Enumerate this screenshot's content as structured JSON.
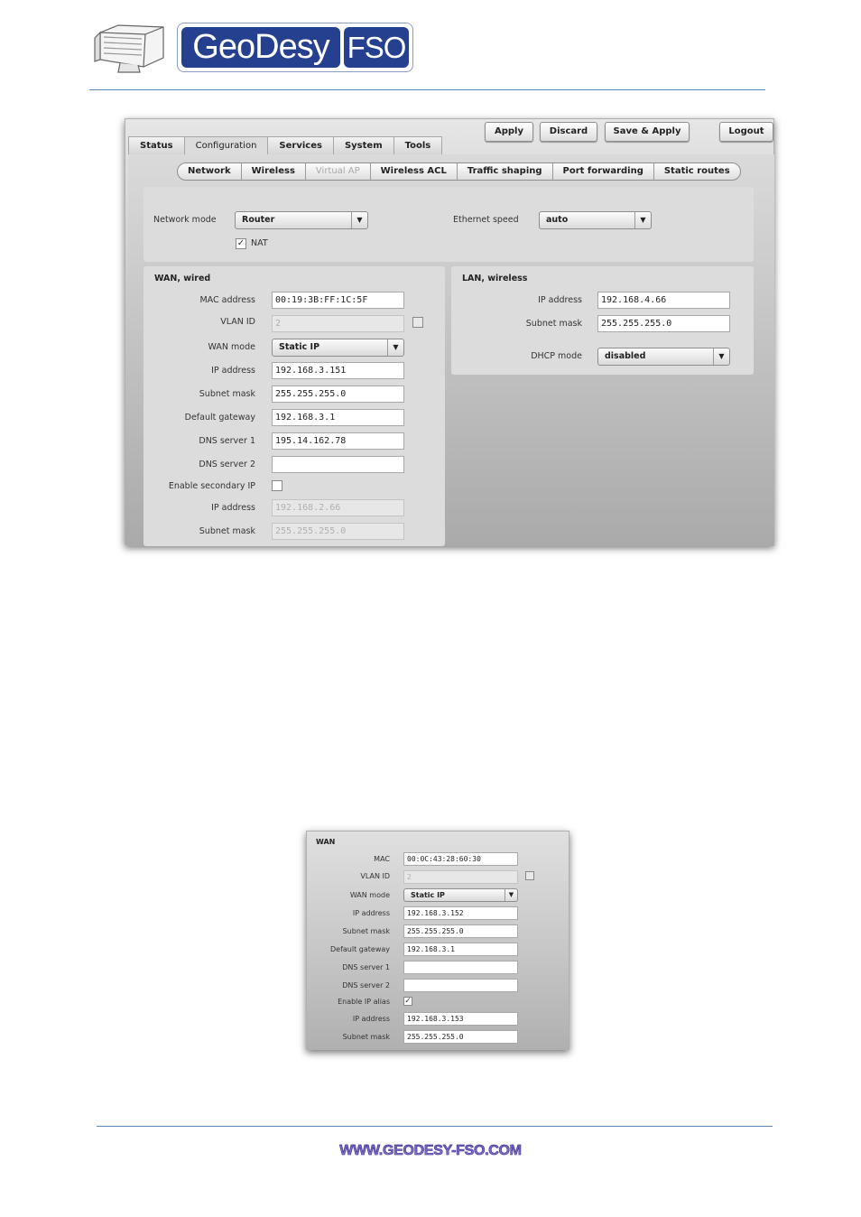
{
  "header": {
    "logo_geo": "GeoDesy",
    "logo_fso": "FSO"
  },
  "shot1": {
    "tabs": [
      {
        "label": "Status",
        "active": false
      },
      {
        "label": "Configuration",
        "active": true
      },
      {
        "label": "Services",
        "active": false
      },
      {
        "label": "System",
        "active": false
      },
      {
        "label": "Tools",
        "active": false
      }
    ],
    "buttons": {
      "apply": "Apply",
      "discard": "Discard",
      "save_apply": "Save & Apply",
      "logout": "Logout"
    },
    "subtabs": [
      {
        "label": "Network",
        "disabled": false
      },
      {
        "label": "Wireless",
        "disabled": false
      },
      {
        "label": "Virtual AP",
        "disabled": true
      },
      {
        "label": "Wireless ACL",
        "disabled": false
      },
      {
        "label": "Traffic shaping",
        "disabled": false
      },
      {
        "label": "Port forwarding",
        "disabled": false
      },
      {
        "label": "Static routes",
        "disabled": false
      }
    ],
    "network_mode_label": "Network mode",
    "network_mode_value": "Router",
    "nat_label": "NAT",
    "nat_checked": "✓",
    "ethernet_speed_label": "Ethernet speed",
    "ethernet_speed_value": "auto",
    "wan": {
      "title": "WAN, wired",
      "mac_label": "MAC address",
      "mac_value": "00:19:3B:FF:1C:5F",
      "vlan_label": "VLAN ID",
      "vlan_value": "2",
      "mode_label": "WAN mode",
      "mode_value": "Static IP",
      "ip_label": "IP address",
      "ip_value": "192.168.3.151",
      "mask_label": "Subnet mask",
      "mask_value": "255.255.255.0",
      "gw_label": "Default gateway",
      "gw_value": "192.168.3.1",
      "dns1_label": "DNS server 1",
      "dns1_value": "195.14.162.78",
      "dns2_label": "DNS server 2",
      "dns2_value": "",
      "sec_label": "Enable secondary IP",
      "ip2_label": "IP address",
      "ip2_value": "192.168.2.66",
      "mask2_label": "Subnet mask",
      "mask2_value": "255.255.255.0"
    },
    "lan": {
      "title": "LAN, wireless",
      "ip_label": "IP address",
      "ip_value": "192.168.4.66",
      "mask_label": "Subnet mask",
      "mask_value": "255.255.255.0",
      "dhcp_label": "DHCP mode",
      "dhcp_value": "disabled"
    }
  },
  "shot2": {
    "title": "WAN",
    "mac_label": "MAC",
    "mac_value": "00:0C:43:28:60:30",
    "vlan_label": "VLAN ID",
    "vlan_value": "2",
    "mode_label": "WAN mode",
    "mode_value": "Static IP",
    "ip_label": "IP address",
    "ip_value": "192.168.3.152",
    "mask_label": "Subnet mask",
    "mask_value": "255.255.255.0",
    "gw_label": "Default gateway",
    "gw_value": "192.168.3.1",
    "dns1_label": "DNS server 1",
    "dns1_value": "",
    "dns2_label": "DNS server 2",
    "dns2_value": "",
    "alias_label": "Enable IP alias",
    "alias_checked": "✓",
    "ip2_label": "IP address",
    "ip2_value": "192.168.3.153",
    "mask2_label": "Subnet mask",
    "mask2_value": "255.255.255.0"
  },
  "footer": {
    "url": "WWW.GEODESY-FSO.COM"
  }
}
